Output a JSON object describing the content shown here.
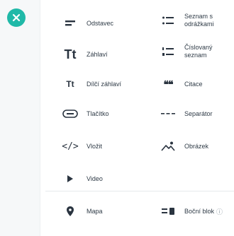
{
  "close_button": {
    "icon": "close-icon",
    "color": "#20b9a8"
  },
  "blocks": {
    "paragraph": {
      "label": "Odstavec",
      "icon": "paragraph-icon"
    },
    "bullet_list": {
      "label": "Seznam s odrážkami",
      "icon": "bullet-list-icon"
    },
    "heading": {
      "label": "Záhlaví",
      "glyph": "Tt",
      "icon": "heading-icon"
    },
    "numbered_list": {
      "label": "Číslovaný seznam",
      "icon": "numbered-list-icon"
    },
    "subheading": {
      "label": "Dílčí záhlaví",
      "glyph": "Tt",
      "icon": "subheading-icon"
    },
    "quote": {
      "label": "Citace",
      "glyph": "❝❝",
      "icon": "quote-icon"
    },
    "button": {
      "label": "Tlačítko",
      "icon": "button-icon"
    },
    "separator": {
      "label": "Separátor",
      "icon": "separator-icon"
    },
    "embed": {
      "label": "Vložit",
      "glyph": "</>",
      "icon": "code-icon"
    },
    "image": {
      "label": "Obrázek",
      "icon": "image-icon"
    },
    "video": {
      "label": "Video",
      "icon": "play-icon"
    },
    "map": {
      "label": "Mapa",
      "icon": "map-pin-icon"
    },
    "sidebar": {
      "label": "Boční blok",
      "info_glyph": "ⓘ",
      "icon": "sidebar-block-icon"
    }
  }
}
